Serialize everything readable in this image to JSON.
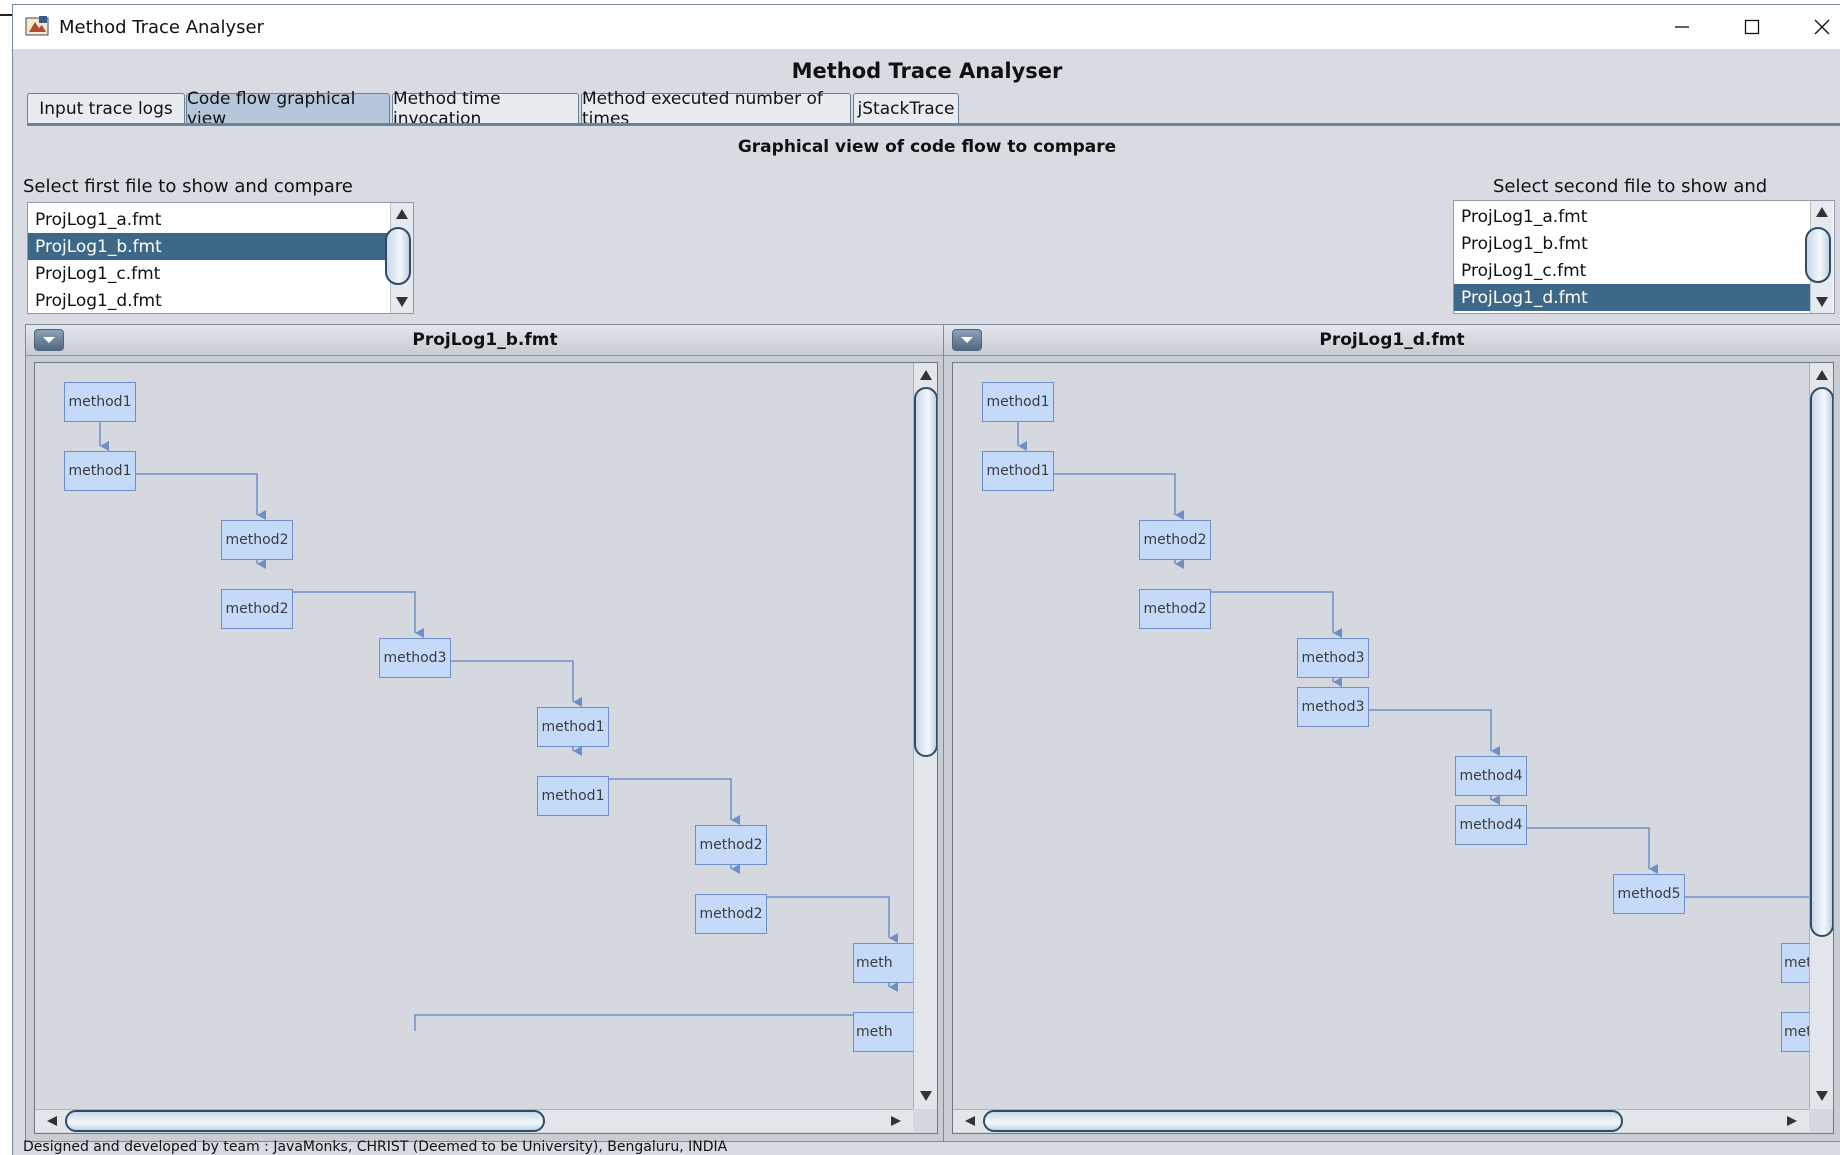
{
  "window": {
    "title": "Method Trace Analyser",
    "controls": [
      "minimize",
      "maximize",
      "close"
    ]
  },
  "header": {
    "title": "Method Trace Analyser"
  },
  "tabs": [
    {
      "label": "Input trace logs",
      "active": false
    },
    {
      "label": "Code flow graphical view",
      "active": true
    },
    {
      "label": "Method time invocation",
      "active": false
    },
    {
      "label": "Method executed number of times",
      "active": false
    },
    {
      "label": "jStackTrace",
      "active": false
    }
  ],
  "main": {
    "subtitle": "Graphical view of code flow to compare",
    "left_select": {
      "label": "Select first file to show and compare",
      "items": [
        "ProjLog1_a.fmt",
        "ProjLog1_b.fmt",
        "ProjLog1_c.fmt",
        "ProjLog1_d.fmt"
      ],
      "selected": "ProjLog1_b.fmt"
    },
    "right_select": {
      "label": "Select second file to show and compare",
      "items": [
        "ProjLog1_a.fmt",
        "ProjLog1_b.fmt",
        "ProjLog1_c.fmt",
        "ProjLog1_d.fmt"
      ],
      "selected": "ProjLog1_d.fmt"
    },
    "left_panel": {
      "title": "ProjLog1_b.fmt",
      "nodes": [
        "method1",
        "method1",
        "method2",
        "method2",
        "method3",
        "method1",
        "method1",
        "method2",
        "method2",
        "meth",
        "meth"
      ]
    },
    "right_panel": {
      "title": "ProjLog1_d.fmt",
      "nodes": [
        "method1",
        "method1",
        "method2",
        "method2",
        "method3",
        "method3",
        "method4",
        "method4",
        "method5",
        "met",
        "met"
      ]
    }
  },
  "footer": {
    "text": "Designed and developed by team : JavaMonks, CHRIST (Deemed to be University), Bengaluru, INDIA"
  },
  "colors": {
    "window_bg": "#d8dbe2",
    "selected_item": "#3e6888",
    "node_fill": "#c5daf8",
    "node_border": "#6d8fc7",
    "edge": "#6d8fc7",
    "active_tab": "#b6c7db"
  }
}
